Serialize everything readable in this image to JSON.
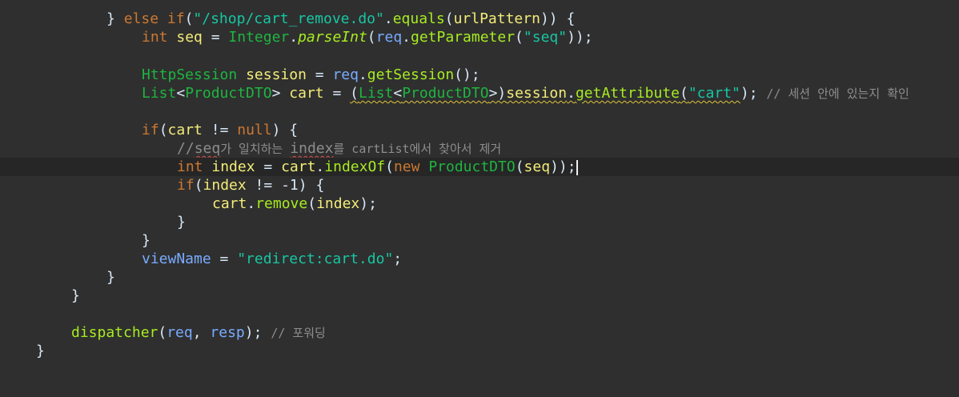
{
  "editor": {
    "theme_colors": {
      "background": "#2f2f2f",
      "current_line": "#262626",
      "keyword": "#cc7832",
      "string": "#17c6a3",
      "class": "#1eb540",
      "field_var": "#79abff",
      "local_var": "#f3ec79",
      "method": "#a7ec21",
      "comment": "#8d8d8d"
    },
    "lines": {
      "l1": {
        "brace": "}",
        "else": "else",
        "if": "if",
        "lp": "(",
        "str": "\"/shop/cart_remove.do\"",
        "dot": ".",
        "equals": "equals",
        "lp2": "(",
        "urlPattern": "urlPattern",
        "rest": ")) {"
      },
      "l2": {
        "int": "int",
        "seq": "seq",
        "eq": " = ",
        "Integer": "Integer",
        "dot": ".",
        "parseInt": "parseInt",
        "lp": "(",
        "req": "req",
        "dot2": ".",
        "getParameter": "getParameter",
        "lp2": "(",
        "str": "\"seq\"",
        "rest": "));"
      },
      "l4": {
        "HttpSession": "HttpSession",
        "session": "session",
        "eq": " = ",
        "req": "req",
        "dot": ".",
        "getSession": "getSession",
        "rest": "();"
      },
      "l5": {
        "List": "List",
        "lt": "<",
        "ProductDTO": "ProductDTO",
        "gt": ">",
        "cart": "cart",
        "eq": " = ",
        "cast_open": "(",
        "List2": "List",
        "lt2": "<",
        "ProductDTO2": "ProductDTO",
        "gt2": ">)",
        "session": "session",
        "dot": ".",
        "getAttribute": "getAttribute",
        "lp": "(",
        "str": "\"cart\"",
        "rest": ");",
        "comment": "// 세션 안에 있는지 확인"
      },
      "l7": {
        "if": "if",
        "lp": "(",
        "cart": "cart",
        "neq": " != ",
        "null": "null",
        "rest": ") {"
      },
      "l8": {
        "c1": "//",
        "seq": "seq",
        "c2": "가 일치하는 ",
        "index": "index",
        "c3": "를 cartList에서 찾아서 제거"
      },
      "l9": {
        "int": "int",
        "index": "index",
        "eq": " = ",
        "cart": "cart",
        "dot": ".",
        "indexOf": "indexOf",
        "lp": "(",
        "new": "new",
        "ProductDTO": "ProductDTO",
        "lp2": "(",
        "seq": "seq",
        "rest": "));"
      },
      "l10": {
        "if": "if",
        "lp": "(",
        "index": "index",
        "neq": " != ",
        "num": "-1",
        "rest": ") {"
      },
      "l11": {
        "cart": "cart",
        "dot": ".",
        "remove": "remove",
        "lp": "(",
        "index": "index",
        "rest": ");"
      },
      "l12": {
        "brace": "}"
      },
      "l13": {
        "brace": "}"
      },
      "l14": {
        "viewName": "viewName",
        "eq": " = ",
        "str": "\"redirect:cart.do\"",
        "rest": ";"
      },
      "l15": {
        "brace": "}"
      },
      "l16": {
        "brace": "}"
      },
      "l18": {
        "dispatcher": "dispatcher",
        "lp": "(",
        "req": "req",
        "comma": ", ",
        "resp": "resp",
        "rest": ");",
        "comment": "// 포워딩"
      },
      "l19": {
        "brace": "}"
      }
    }
  }
}
